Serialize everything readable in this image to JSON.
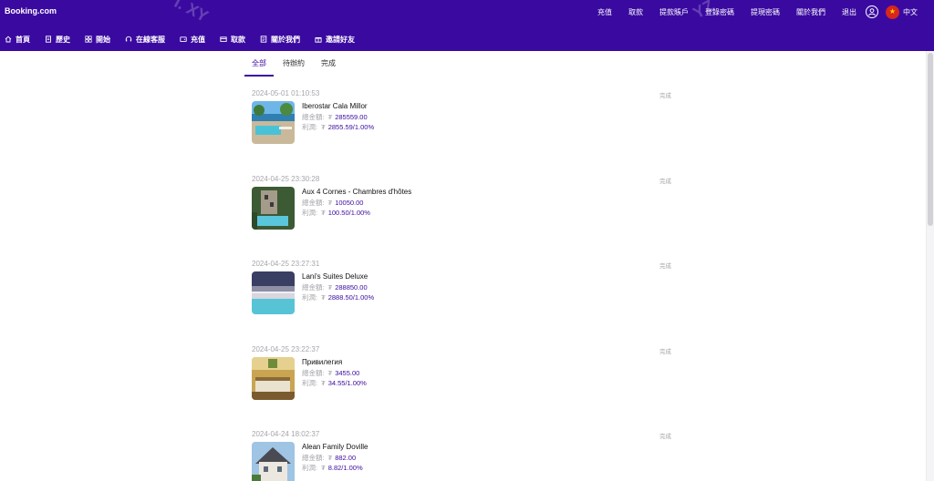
{
  "header": {
    "brand": "Booking.com",
    "links": [
      "充值",
      "取款",
      "提款賬戶",
      "登錄密碼",
      "提現密碼",
      "關於我們",
      "退出"
    ],
    "language": "中文"
  },
  "nav": {
    "items": [
      {
        "label": "首頁",
        "icon": "home-icon"
      },
      {
        "label": "歷史",
        "icon": "document-icon"
      },
      {
        "label": "開始",
        "icon": "grid-icon"
      },
      {
        "label": "在線客服",
        "icon": "headset-icon"
      },
      {
        "label": "充值",
        "icon": "wallet-icon"
      },
      {
        "label": "取款",
        "icon": "card-icon"
      },
      {
        "label": "關於我們",
        "icon": "info-icon"
      },
      {
        "label": "邀請好友",
        "icon": "gift-icon"
      }
    ]
  },
  "tabs": [
    "全部",
    "待辦約",
    "完成"
  ],
  "orders": [
    {
      "time": "2024-05-01 01:10:53",
      "status": "完成",
      "name": "Iberostar Cala Millor",
      "total_label": "總金額:",
      "total": "285559.00",
      "profit_label": "利潤:",
      "profit": "2855.59/1.00%"
    },
    {
      "time": "2024-04-25 23:30:28",
      "status": "完成",
      "name": "Aux 4 Cornes - Chambres d'hôtes",
      "total_label": "總金額:",
      "total": "10050.00",
      "profit_label": "利潤:",
      "profit": "100.50/1.00%"
    },
    {
      "time": "2024-04-25 23:27:31",
      "status": "完成",
      "name": "Lani's Suites Deluxe",
      "total_label": "總金額:",
      "total": "288850.00",
      "profit_label": "利潤:",
      "profit": "2888.50/1.00%"
    },
    {
      "time": "2024-04-25 23:22:37",
      "status": "完成",
      "name": "Привилегия",
      "total_label": "總金額:",
      "total": "3455.00",
      "profit_label": "利潤:",
      "profit": "34.55/1.00%"
    },
    {
      "time": "2024-04-24 18:02:37",
      "status": "完成",
      "name": "Alean Family Doville",
      "total_label": "總金額:",
      "total": "882.00",
      "profit_label": "利潤:",
      "profit": "8.82/1.00%"
    }
  ],
  "currency_symbol": "₮",
  "colors": {
    "brand": "#3a0aa0",
    "muted": "#a6a6ad"
  }
}
